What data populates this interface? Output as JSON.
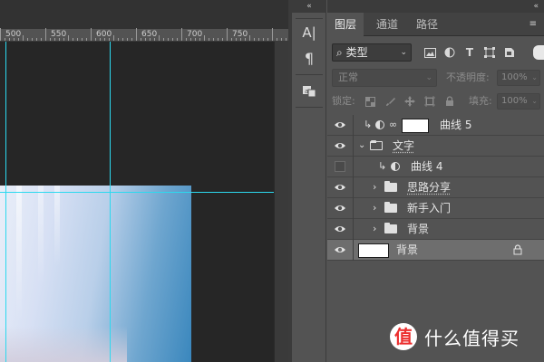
{
  "ruler": {
    "labels": [
      "500",
      "550",
      "600",
      "650",
      "700",
      "750"
    ]
  },
  "tool_strip": {
    "collapse_glyph": "«",
    "items": [
      {
        "name": "character-panel-icon",
        "glyph": "A|"
      },
      {
        "name": "paragraph-panel-icon",
        "glyph": "¶"
      },
      {
        "name": "glyphs-panel-icon",
        "glyph": "☰"
      }
    ]
  },
  "panel": {
    "collapse_glyph": "«",
    "tabs": [
      {
        "label": "图层",
        "active": true
      },
      {
        "label": "通道",
        "active": false
      },
      {
        "label": "路径",
        "active": false
      }
    ],
    "menu_glyph": "≡",
    "filter": {
      "search_glyph": "⌕",
      "kind": "类型",
      "chevron": "⌄"
    },
    "blend": {
      "mode": "正常",
      "chevron": "⌄",
      "opacity_label": "不透明度:",
      "opacity_value": "100%",
      "fill_label": "填充:",
      "fill_value": "100%"
    },
    "lock_label": "锁定:",
    "layers": [
      {
        "name": "曲线 5",
        "visible": true,
        "kind": "adjustment-clipped",
        "selected": false
      },
      {
        "name": "文字",
        "visible": true,
        "kind": "group-open",
        "selected": false
      },
      {
        "name": "曲线 4",
        "visible": false,
        "kind": "adjustment-clipped-nested",
        "selected": false
      },
      {
        "name": "思路分享",
        "visible": true,
        "kind": "group-nested",
        "selected": false
      },
      {
        "name": "新手入门",
        "visible": true,
        "kind": "group-nested",
        "selected": false
      },
      {
        "name": "背景",
        "visible": true,
        "kind": "group-nested",
        "selected": false
      },
      {
        "name": "背景",
        "visible": true,
        "kind": "background",
        "selected": true
      }
    ]
  },
  "watermark": {
    "badge": "值",
    "text": "什么值得买"
  },
  "colors": {
    "guide": "#2cd9ef",
    "panel_bg": "#535353",
    "selected_row": "#6e6e6e",
    "watermark_red": "#ec2f2f"
  }
}
